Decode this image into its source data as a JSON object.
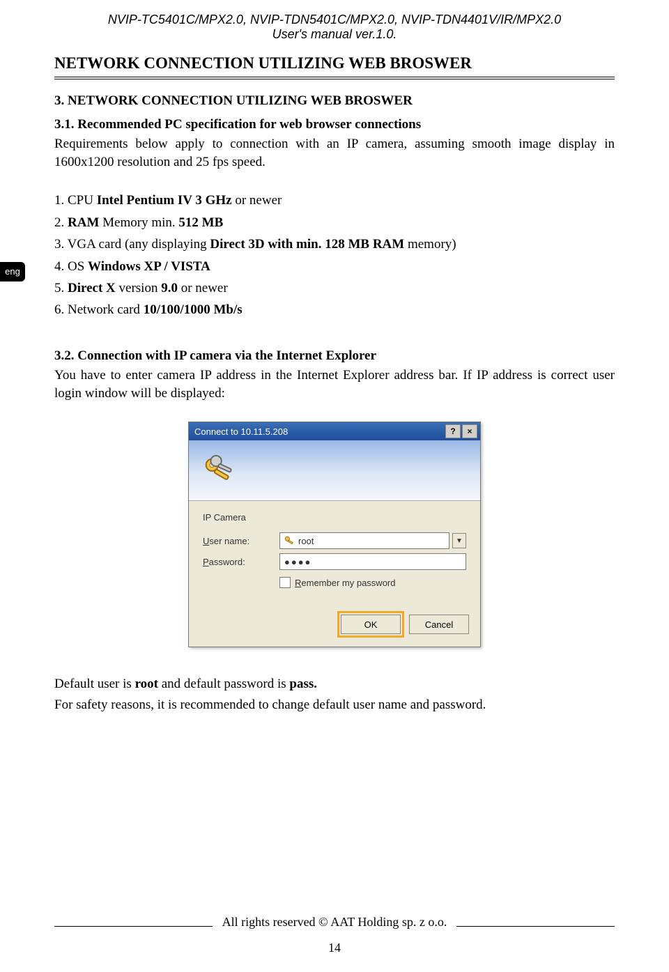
{
  "header": {
    "line1": "NVIP-TC5401C/MPX2.0, NVIP-TDN5401C/MPX2.0, NVIP-TDN4401V/IR/MPX2.0",
    "line2": "User's manual ver.1.0."
  },
  "langTab": "eng",
  "sectionTitle": "NETWORK CONNECTION UTILIZING WEB BROSWER",
  "s3": {
    "heading": "3. NETWORK CONNECTION UTILIZING WEB BROSWER",
    "s31_heading": "3.1. Recommended PC specification for web browser connections",
    "s31_para": "Requirements below  apply to connection with an IP camera, assuming smooth image display in 1600x1200 resolution and 25 fps speed."
  },
  "specs": {
    "i1_pre": "1. CPU ",
    "i1_b": "Intel Pentium IV 3 GHz",
    "i1_post": " or newer",
    "i2_pre": "2. ",
    "i2_b1": "RAM",
    "i2_mid": " Memory min. ",
    "i2_b2": "512 MB",
    "i3_pre": "3. VGA card (any displaying ",
    "i3_b1": "Direct 3D with min. 128 MB RAM",
    "i3_post": " memory)",
    "i4_pre": "4. OS ",
    "i4_b": "Windows XP / VISTA",
    "i5_pre": "5. ",
    "i5_b": "Direct X",
    "i5_mid": " version ",
    "i5_b2": "9.0",
    "i5_post": " or newer",
    "i6_pre": "6. Network card ",
    "i6_b": "10/100/1000 Mb/s"
  },
  "s32": {
    "heading": "3.2. Connection with IP camera via the Internet Explorer",
    "para": "You have to enter camera IP address in the Internet Explorer address bar. If IP address is correct user login window will be displayed:"
  },
  "dialog": {
    "title": "Connect to 10.11.5.208",
    "help": "?",
    "close": "×",
    "realm": "IP Camera",
    "user_label_pre": "",
    "user_label_u": "U",
    "user_label_post": "ser name:",
    "pass_label_pre": "",
    "pass_label_u": "P",
    "pass_label_post": "assword:",
    "username": "root",
    "password": "●●●●",
    "remember_u": "R",
    "remember_post": "emember my password",
    "ok": "OK",
    "cancel": "Cancel"
  },
  "tail": {
    "p1_pre": "Default user is ",
    "p1_b1": "root",
    "p1_mid": " and default password is ",
    "p1_b2": "pass.",
    "p2": "For safety reasons, it is recommended to change default user name and password."
  },
  "footer": {
    "rights": "All rights reserved © AAT Holding sp. z o.o.",
    "page": "14"
  }
}
